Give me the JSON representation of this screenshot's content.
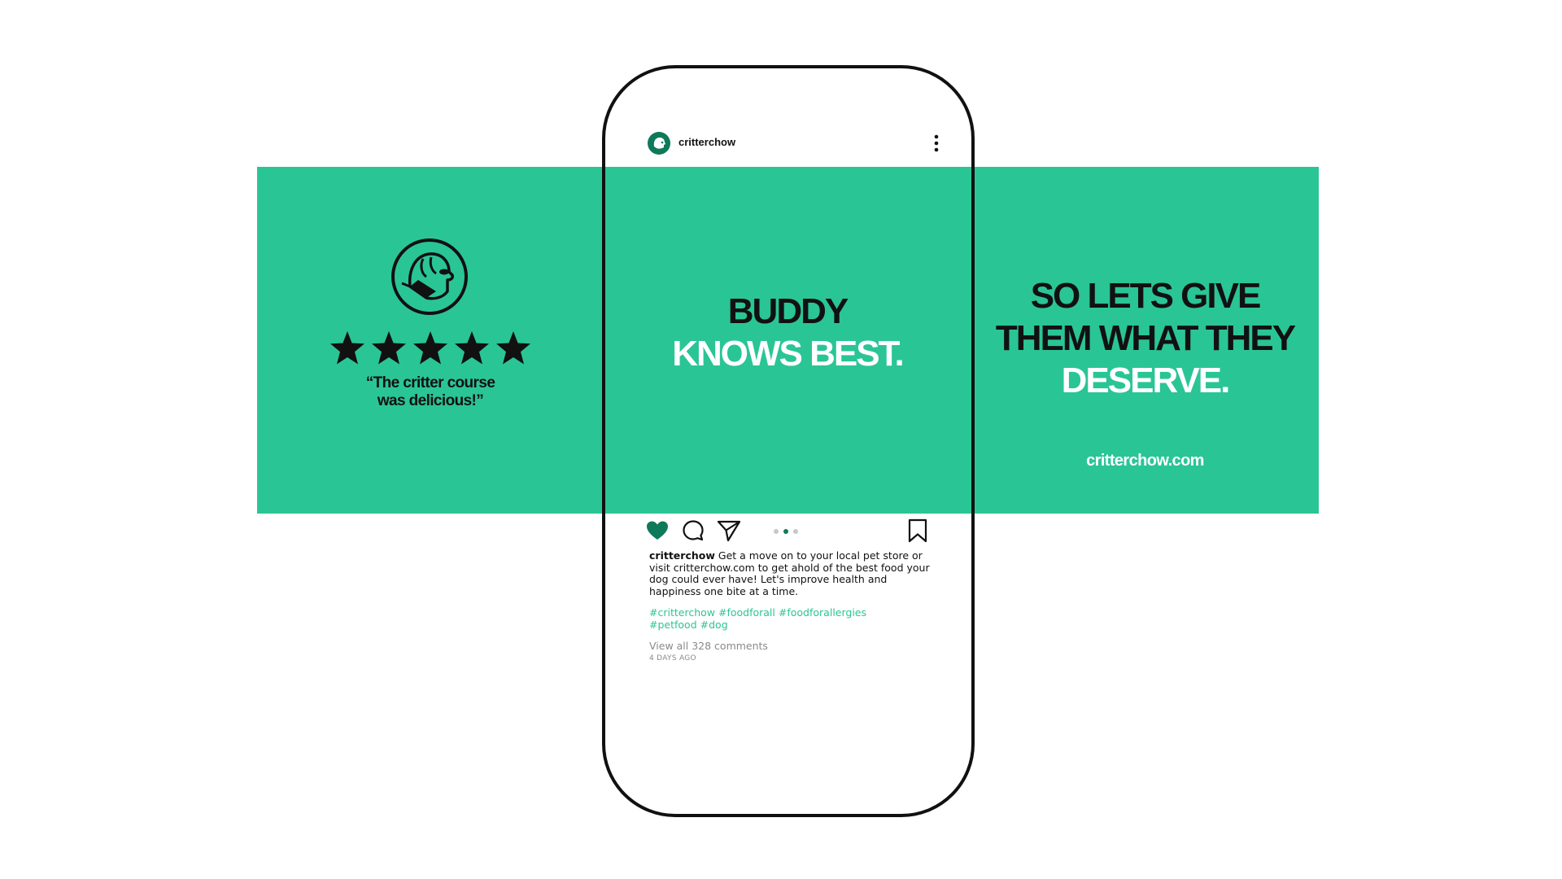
{
  "post": {
    "username": "critterchow",
    "caption": "Get a move on to your local pet store or visit critterchow.com to get ahold of the best food your dog could ever have! Let's improve health and happiness one bite at a time.",
    "hashtags": [
      "#critterchow",
      "#foodforall",
      "#foodforallergies",
      "#petfood",
      "#dog"
    ],
    "comments_link": "View all 328 comments",
    "date": "4 DAYS AGO",
    "liked": true,
    "carousel": {
      "count": 3,
      "active_index": 1
    }
  },
  "slides": {
    "left": {
      "rating": 5,
      "quote_line1": "“The critter course",
      "quote_line2": "was delicious!”"
    },
    "middle": {
      "line1": "BUDDY",
      "line2": "KNOWS BEST."
    },
    "right": {
      "line1": "SO LETS GIVE",
      "line2": "THEM WHAT THEY",
      "line3": "DESERVE.",
      "url": "critterchow.com"
    }
  },
  "colors": {
    "brand_green": "#2ac595",
    "dark_green": "#0e7a5a",
    "ink": "#111111",
    "muted": "#8a8a8a"
  },
  "icons": {
    "avatar": "critterchow-logo-icon",
    "more": "more-vertical-icon",
    "like": "heart-icon",
    "comment": "comment-icon",
    "share": "send-icon",
    "save": "bookmark-icon",
    "rating": "star-icon"
  }
}
